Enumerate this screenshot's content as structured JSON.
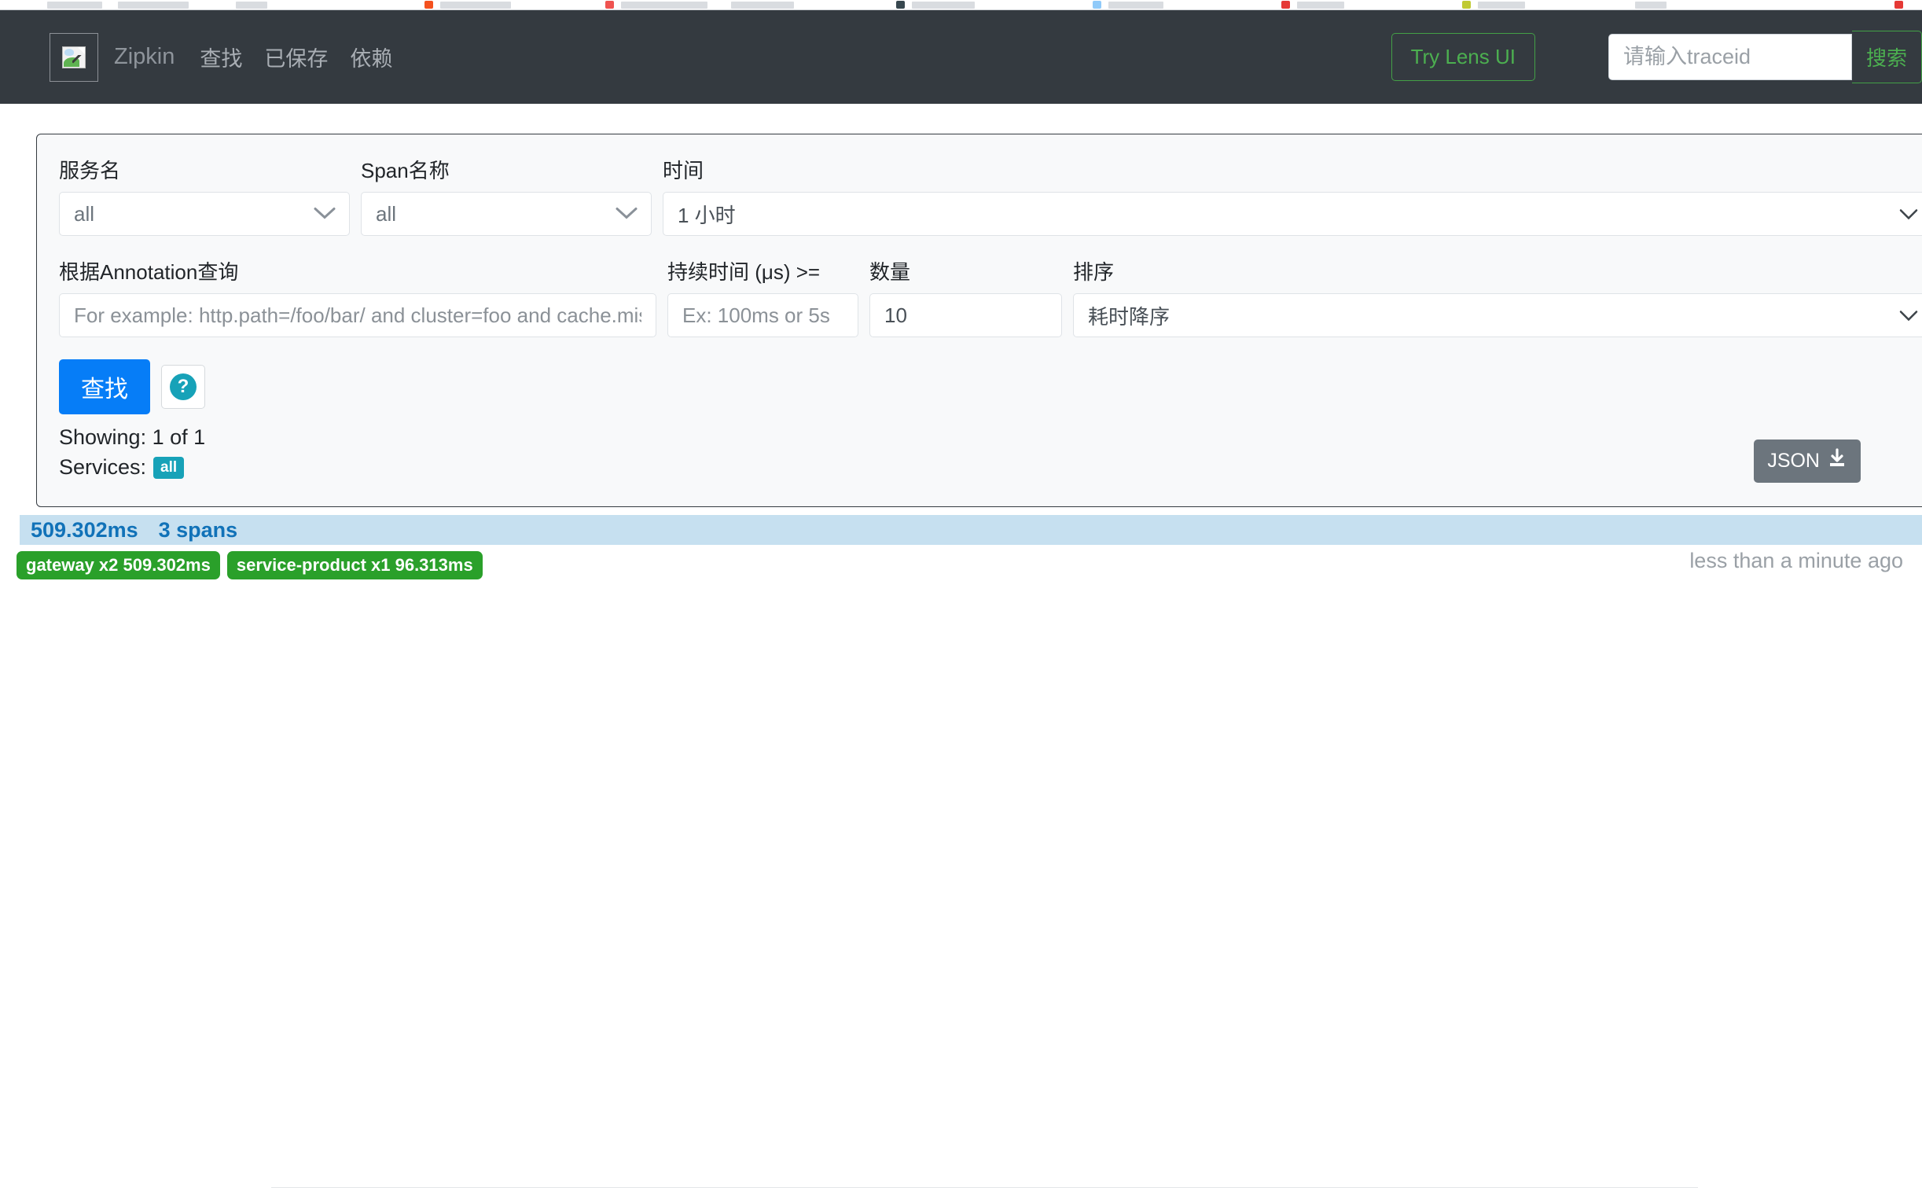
{
  "browser": {
    "bookmark_swatches": [
      "#f4511e",
      "#ef5350",
      "#37474f",
      "#90caf9",
      "#e53935",
      "#c0ca33",
      "#9e9e9e",
      "#e53935"
    ]
  },
  "header": {
    "logo_icon": "broken-image-icon",
    "brand": "Zipkin",
    "nav": [
      {
        "label": "查找",
        "name": "nav-find"
      },
      {
        "label": "已保存",
        "name": "nav-saved"
      },
      {
        "label": "依赖",
        "name": "nav-dependencies"
      }
    ],
    "lens_button": "Try Lens UI",
    "traceid_placeholder": "请输入traceid",
    "traceid_value": "",
    "search_button": "搜索",
    "bg_color": "#343a40",
    "accent_green": "#4caf50"
  },
  "search_form": {
    "service_name": {
      "label": "服务名",
      "value": "all"
    },
    "span_name": {
      "label": "Span名称",
      "value": "all"
    },
    "time": {
      "label": "时间",
      "value": "1 小时"
    },
    "annotation": {
      "label": "根据Annotation查询",
      "placeholder": "For example: http.path=/foo/bar/ and cluster=foo and cache.miss",
      "value": ""
    },
    "duration": {
      "label": "持续时间 (μs) >=",
      "placeholder": "Ex: 100ms or 5s",
      "value": ""
    },
    "count": {
      "label": "数量",
      "value": "10"
    },
    "sort": {
      "label": "排序",
      "value": "耗时降序"
    },
    "find_button": "查找",
    "help_icon": "question-mark-icon",
    "showing": "Showing: 1 of 1",
    "services_label": "Services:",
    "services_badge": "all",
    "json_button": "JSON",
    "json_icon": "download-icon",
    "primary_color": "#067df7",
    "badge_color": "#17a2b8"
  },
  "results": {
    "traces": [
      {
        "duration": "509.302ms",
        "spans": "3 spans",
        "services": [
          "gateway x2 509.302ms",
          "service-product x1 96.313ms"
        ],
        "time_ago": "less than a minute ago"
      }
    ],
    "bar_color": "#c6e0f0",
    "bar_text_color": "#1172b8",
    "service_pill_color": "#2aa02a"
  }
}
